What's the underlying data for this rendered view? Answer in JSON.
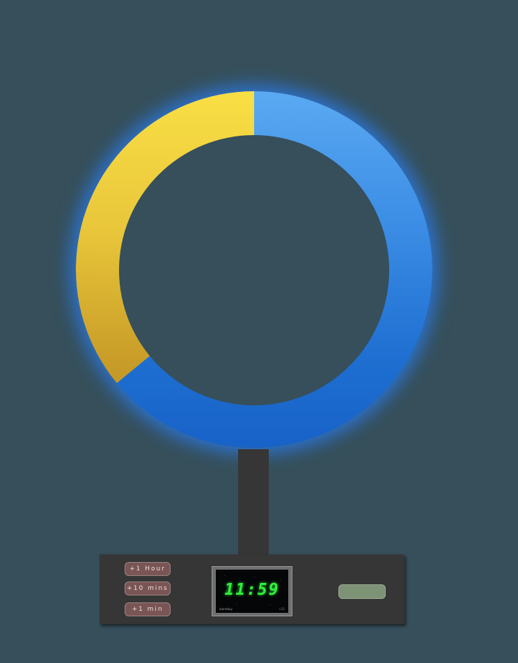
{
  "ring": {
    "progress_fraction": 0.36,
    "elapsed_color": "#e8c53a",
    "remaining_color": "#3d8fe6",
    "glow_color": "#2882ff"
  },
  "controls": {
    "add_hour_label": "+1 Hour",
    "add_ten_mins_label": "+10 mins",
    "add_min_label": "+1 min"
  },
  "clock": {
    "time": "11:59",
    "ghost": "88:88",
    "digit_color": "#2ff03c",
    "brand": "alarmbuy",
    "model": "LED"
  },
  "indicator": {
    "color": "#7e9375"
  }
}
